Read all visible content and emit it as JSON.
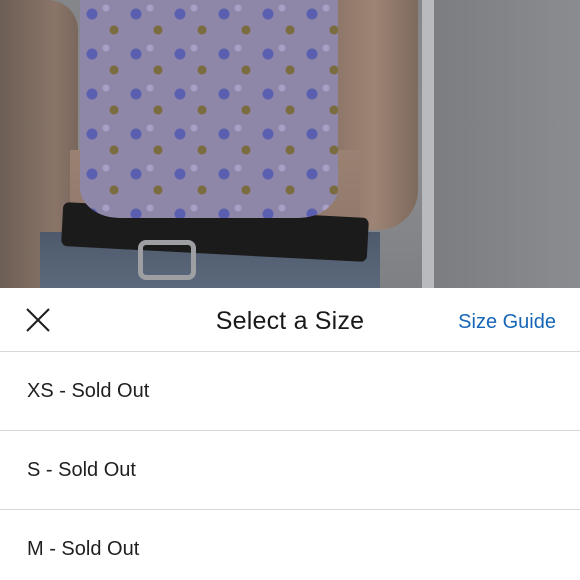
{
  "product_image": {
    "alt": ""
  },
  "size_sheet": {
    "title": "Select a Size",
    "size_guide_label": "Size Guide",
    "close_icon": "close-icon",
    "sizes": [
      {
        "label": "XS - Sold Out"
      },
      {
        "label": "S - Sold Out"
      },
      {
        "label": "M - Sold Out"
      }
    ]
  },
  "colors": {
    "link": "#1666b8",
    "divider": "#d7d7d7",
    "text": "#1f1f1f"
  }
}
